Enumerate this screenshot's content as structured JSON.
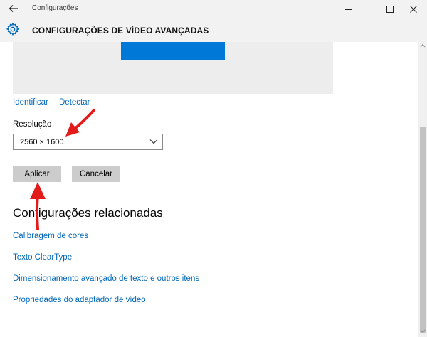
{
  "window": {
    "app_title": "Configurações",
    "page_title": "CONFIGURAÇÕES DE VÍDEO AVANÇADAS"
  },
  "display": {
    "identify_link": "Identificar",
    "detect_link": "Detectar"
  },
  "resolution": {
    "label": "Resolução",
    "selected_value": "2560 × 1600"
  },
  "actions": {
    "apply_label": "Aplicar",
    "cancel_label": "Cancelar"
  },
  "related": {
    "title": "Configurações relacionadas",
    "links": [
      "Calibragem de cores",
      "Texto ClearType",
      "Dimensionamento avançado de texto e outros itens",
      "Propriedades do adaptador de vídeo"
    ]
  },
  "colors": {
    "accent": "#0067b8",
    "monitor": "#0078d7",
    "button": "#cccccc",
    "annotation_arrow": "#e21a1a"
  },
  "icons": {
    "back": "back-arrow-icon",
    "settings": "gear-icon",
    "minimize": "minimize-icon",
    "maximize": "maximize-icon",
    "close": "close-icon",
    "dropdown": "chevron-down-icon"
  }
}
